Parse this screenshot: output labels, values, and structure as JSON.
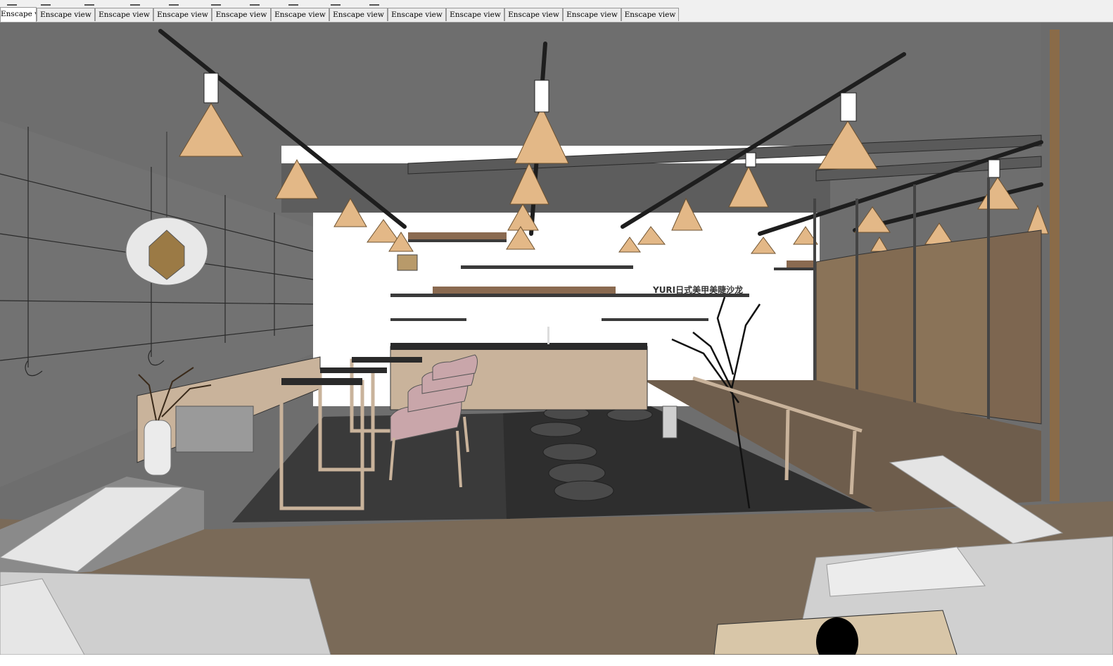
{
  "toolbar": {
    "icons": [
      "undo-icon",
      "redo-icon",
      "paint-icon",
      "print-icon",
      "select-icon",
      "orbit-icon",
      "pan-icon",
      "zoom-icon",
      "section-icon",
      "scene-icon"
    ]
  },
  "tabs": [
    {
      "label": "Enscape view",
      "active": true
    },
    {
      "label": "Enscape view",
      "active": false
    },
    {
      "label": "Enscape view",
      "active": false
    },
    {
      "label": "Enscape view",
      "active": false
    },
    {
      "label": "Enscape view",
      "active": false
    },
    {
      "label": "Enscape view",
      "active": false
    },
    {
      "label": "Enscape view",
      "active": false
    },
    {
      "label": "Enscape view",
      "active": false
    },
    {
      "label": "Enscape view",
      "active": false
    },
    {
      "label": "Enscape view",
      "active": false
    },
    {
      "label": "Enscape view",
      "active": false
    },
    {
      "label": "Enscape view",
      "active": false
    }
  ],
  "scene": {
    "wall_sign": "YURI日式美甲美睫沙龙",
    "colors": {
      "ceiling": "#6e6e6e",
      "wall": "#747474",
      "back_wall": "#ffffff",
      "lamp": "#e3b887",
      "wood_floor": "#7a6a58",
      "dark_floor": "#3a3a3a",
      "counter": "#c9b39b",
      "chair": "#c9a6aa",
      "bed": "#e4e4e4",
      "screen": "#8a7358"
    }
  }
}
